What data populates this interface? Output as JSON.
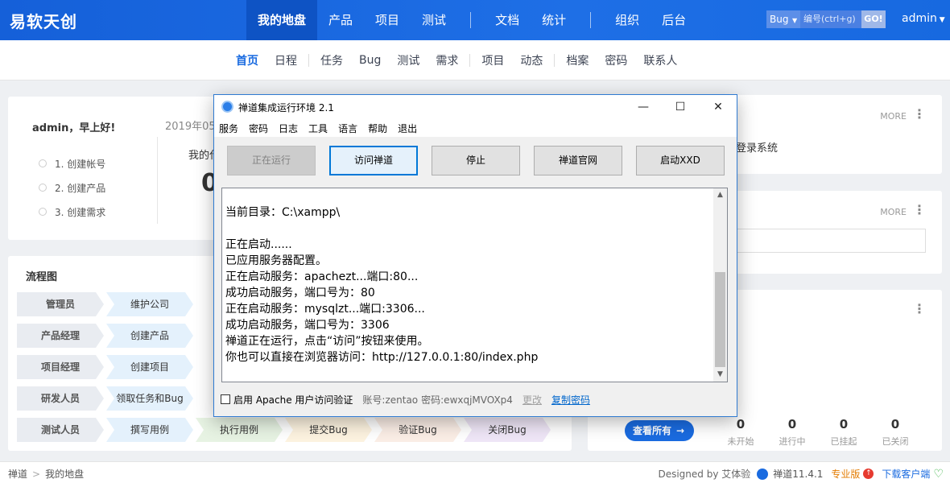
{
  "header": {
    "brand": "易软天创",
    "nav": [
      "我的地盘",
      "产品",
      "项目",
      "测试",
      "文档",
      "统计",
      "组织",
      "后台"
    ],
    "search": {
      "type": "Bug",
      "placeholder": "编号(ctrl+g)",
      "go": "GO!"
    },
    "user": "admin"
  },
  "subnav": [
    "首页",
    "日程",
    "任务",
    "Bug",
    "测试",
    "需求",
    "项目",
    "动态",
    "档案",
    "密码",
    "联系人"
  ],
  "greeting": {
    "hello": "admin，早上好!",
    "date": "2019年05",
    "steps": [
      "1. 创建帐号",
      "2. 创建产品",
      "3. 创建需求"
    ],
    "mine": "我的代",
    "bignum": "0"
  },
  "flow": {
    "title": "流程图",
    "rows": [
      {
        "role": "管理员",
        "acts": [
          "维护公司"
        ]
      },
      {
        "role": "产品经理",
        "acts": [
          "创建产品"
        ]
      },
      {
        "role": "项目经理",
        "acts": [
          "创建项目"
        ]
      },
      {
        "role": "研发人员",
        "acts": [
          "领取任务和Bug"
        ]
      },
      {
        "role": "测试人员",
        "acts": [
          "撰写用例",
          "执行用例",
          "提交Bug",
          "验证Bug",
          "关闭Bug"
        ]
      }
    ]
  },
  "right": {
    "more": "MORE",
    "login_text": "登录系统",
    "view_all": "查看所有",
    "stats": [
      {
        "n": "0",
        "l": "未开始"
      },
      {
        "n": "0",
        "l": "进行中"
      },
      {
        "n": "0",
        "l": "已挂起"
      },
      {
        "n": "0",
        "l": "已关闭"
      }
    ]
  },
  "footer": {
    "crumbs": [
      "禅道",
      "我的地盘"
    ],
    "designed": "Designed by 艾体验",
    "version": "禅道11.4.1",
    "pro": "专业版",
    "download": "下载客户端"
  },
  "dialog": {
    "title": "禅道集成运行环境 2.1",
    "menu": [
      "服务",
      "密码",
      "日志",
      "工具",
      "语言",
      "帮助",
      "退出"
    ],
    "buttons": [
      "正在运行",
      "访问禅道",
      "停止",
      "禅道官网",
      "启动XXD"
    ],
    "log": [
      "当前目录：C:\\xampp\\",
      "",
      "正在启动......",
      "已应用服务器配置。",
      "正在启动服务：apachezt...端口:80...",
      "成功启动服务，端口号为：80",
      "正在启动服务：mysqlzt...端口:3306...",
      "成功启动服务，端口号为：3306",
      "禅道正在运行，点击“访问”按钮来使用。",
      "你也可以直接在浏览器访问：http://127.0.0.1:80/index.php"
    ],
    "checkbox_label": "启用 Apache 用户访问验证",
    "account": "账号:zentao",
    "password": "密码:ewxqjMVOXp4",
    "change": "更改",
    "copy": "复制密码"
  }
}
